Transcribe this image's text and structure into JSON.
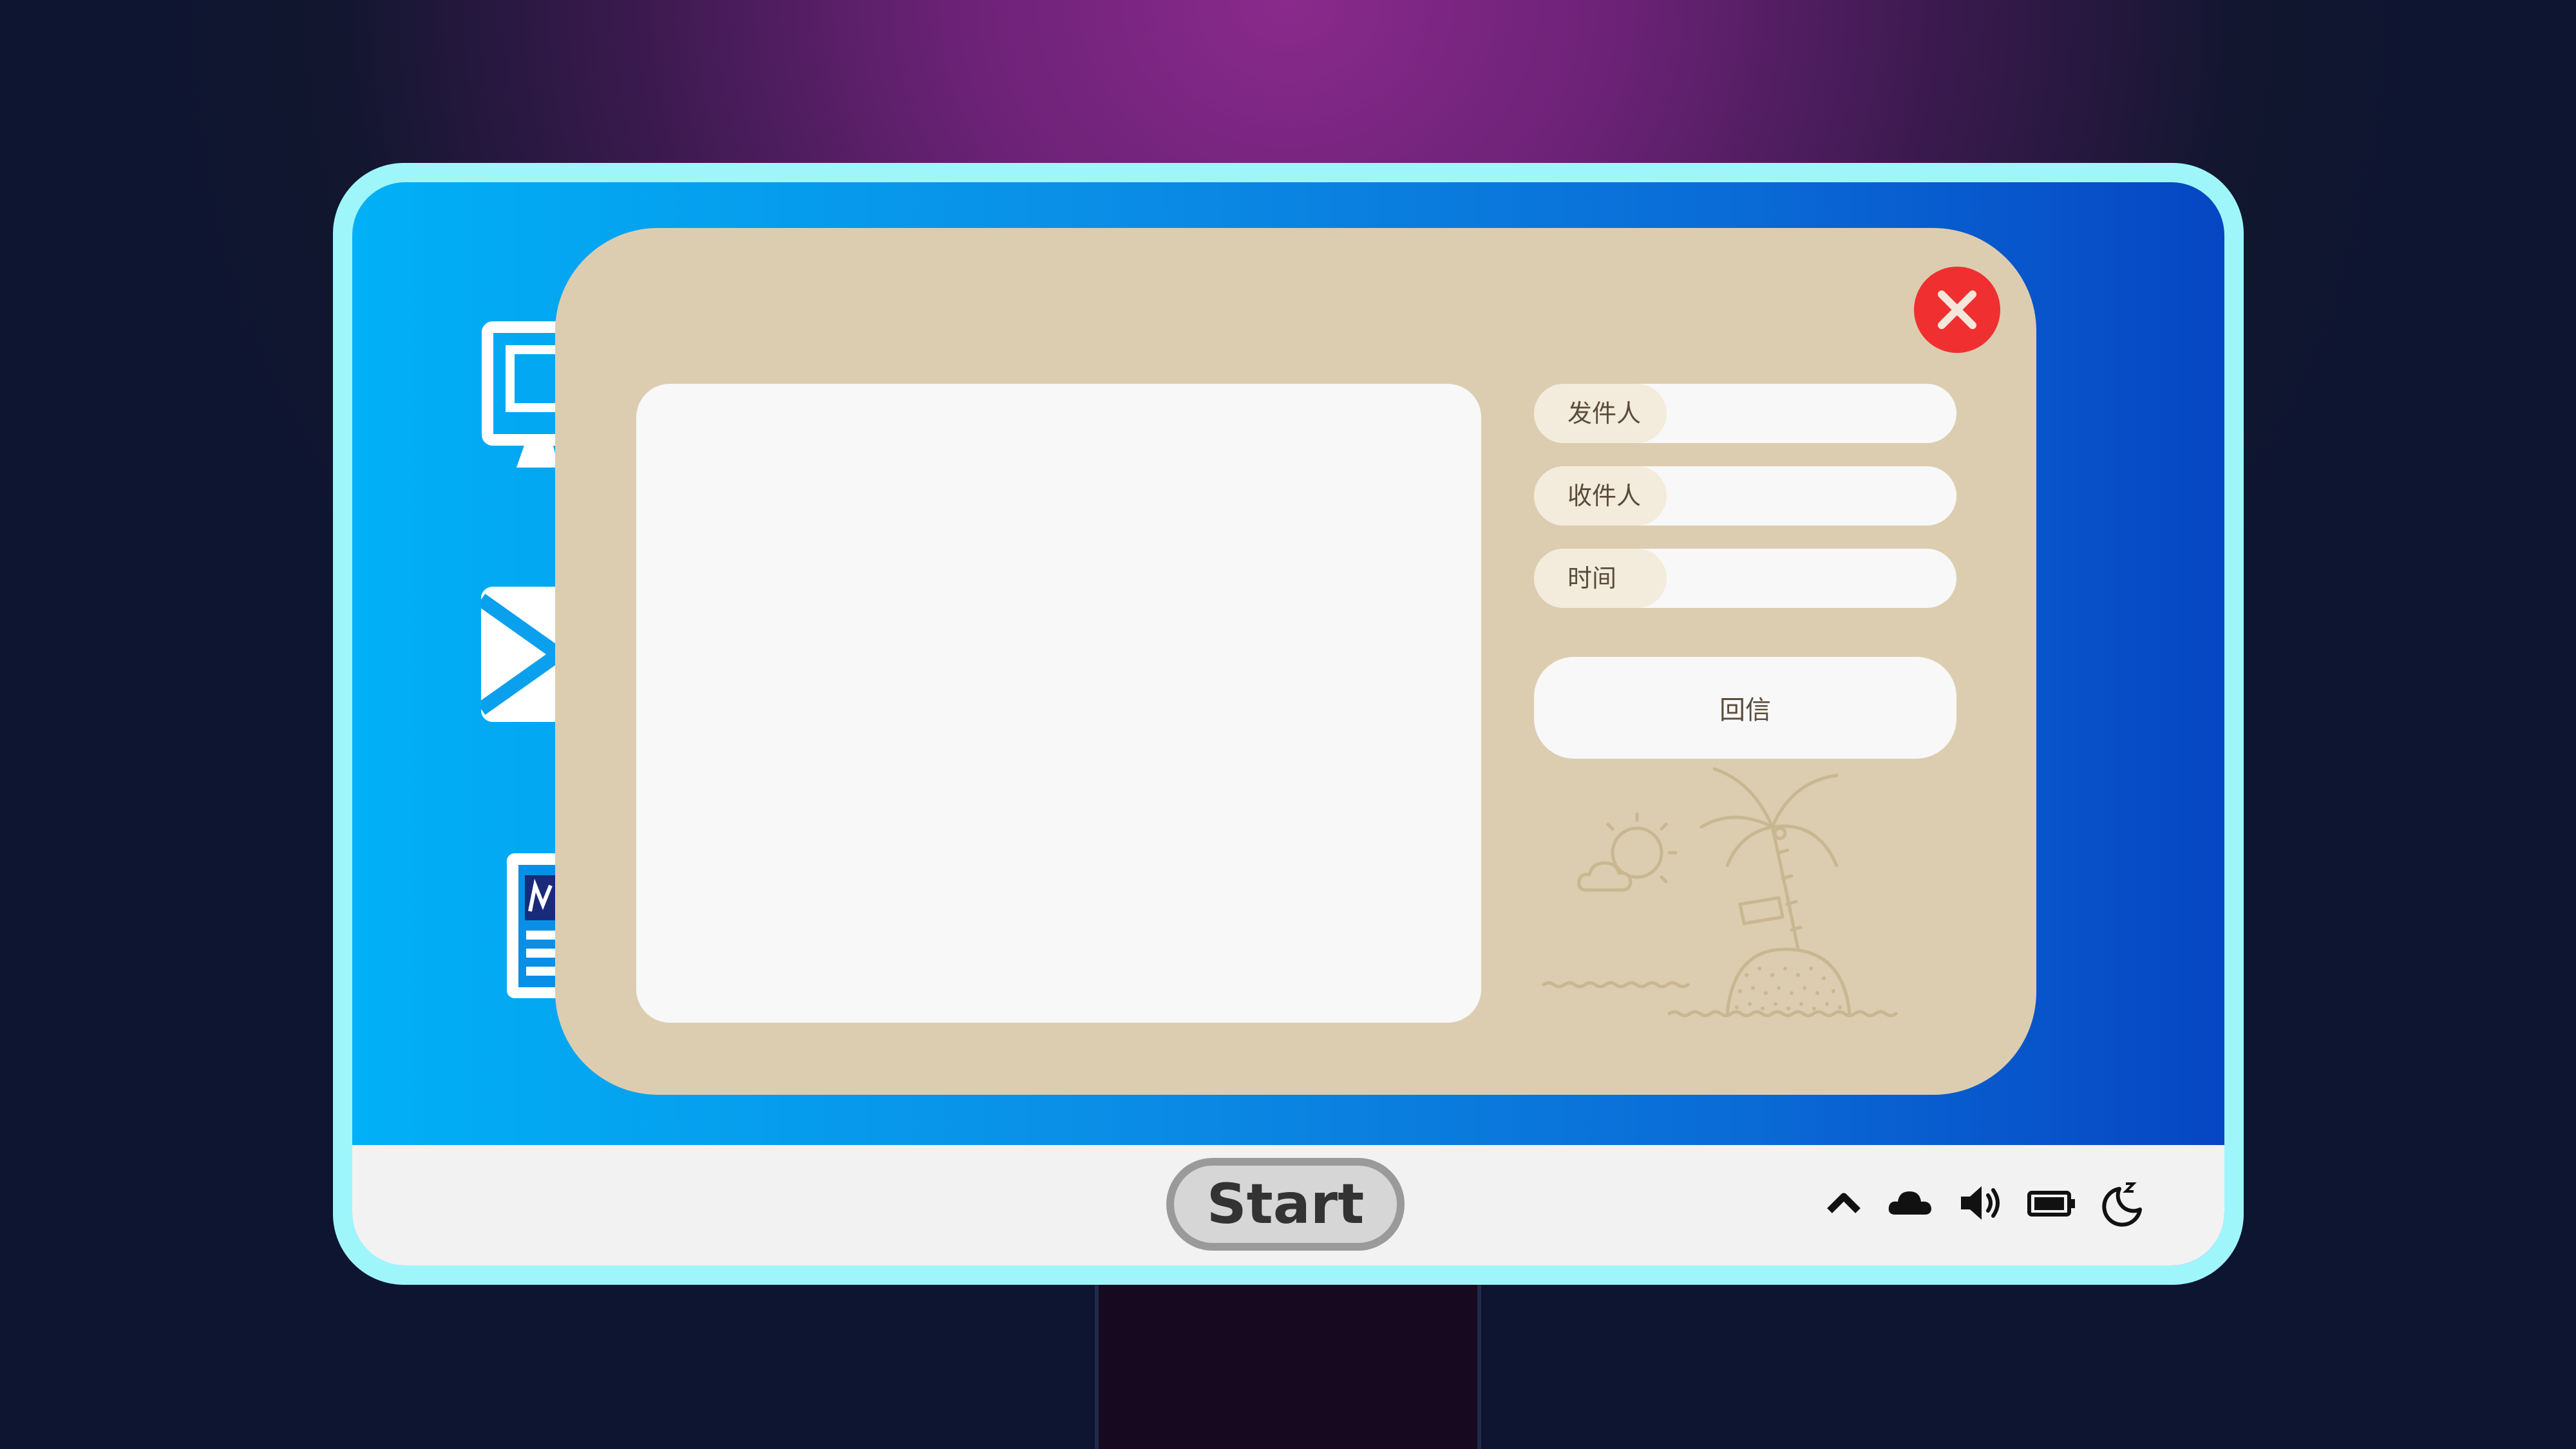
{
  "taskbar": {
    "start_label": "Start"
  },
  "desktop": {
    "icons": [
      "monitor-icon",
      "mail-icon",
      "document-icon"
    ]
  },
  "tray": {
    "icons": [
      "chevron-up-icon",
      "cloud-icon",
      "volume-icon",
      "battery-icon",
      "sleep-icon"
    ]
  },
  "mail_window": {
    "from_label": "发件人",
    "from_value": "",
    "to_label": "收件人",
    "to_value": "",
    "time_label": "时间",
    "time_value": "",
    "body": "",
    "reply_label": "回信"
  },
  "colors": {
    "accent_close": "#f03030",
    "window_bg": "#dccdb0",
    "monitor_frame": "#9ef6fb"
  }
}
